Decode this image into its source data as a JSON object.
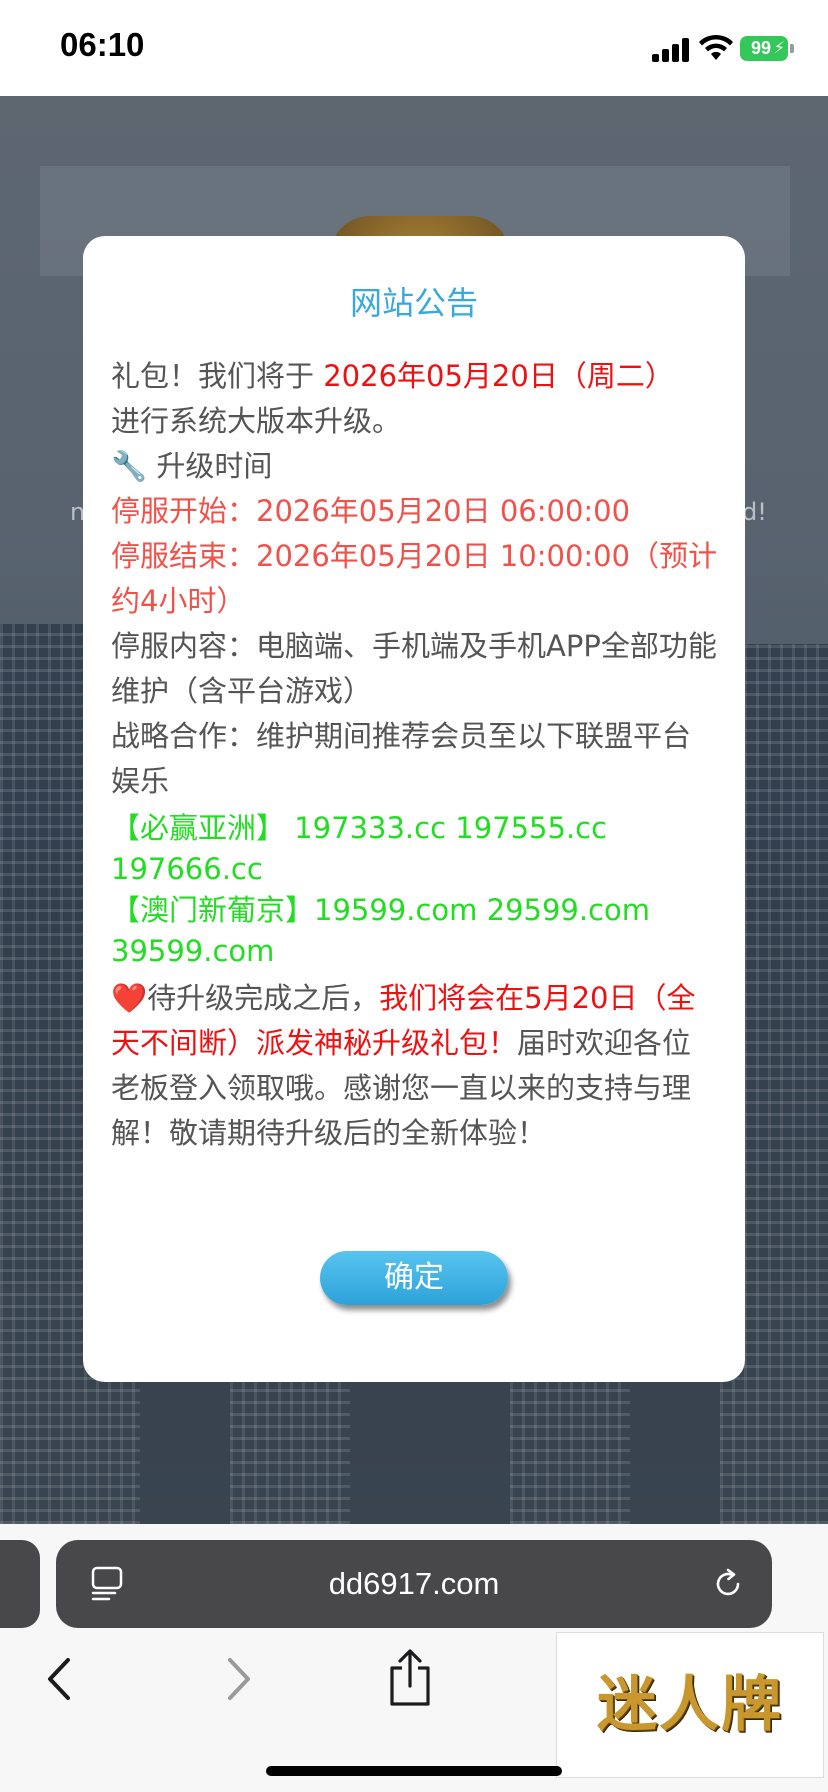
{
  "status_bar": {
    "time": "06:10",
    "battery": "99"
  },
  "background": {
    "marquee_left": "n",
    "marquee_right": "d!"
  },
  "modal": {
    "title": "网站公告",
    "intro_prefix": "礼包！我们将于 ",
    "intro_date": "2026年05月20日（周二）",
    "intro_suffix": "进行系统大版本升级。",
    "upgrade_time_icon": "🔧",
    "upgrade_time_label": " 升级时间",
    "stop_start": "停服开始：2026年05月20日 06:00:00",
    "stop_end": "停服结束：2026年05月20日 10:00:00（预计约4小时）",
    "stop_content": "停服内容：电脑端、手机端及手机APP全部功能维护（含平台游戏）",
    "partnership": "战略合作：维护期间推荐会员至以下联盟平台娱乐",
    "partner_1": "【必赢亚洲】  197333.cc  197555.cc  197666.cc",
    "partner_2": "【澳门新葡京】19599.com 29599.com 39599.com",
    "heart_icon": "❤️",
    "closing_prefix": "待升级完成之后，",
    "closing_red": "我们将会在5月20日（全天不间断）派发神秘升级礼包！",
    "closing_suffix": "届时欢迎各位老板登入领取哦。感谢您一直以来的支持与理解！敬请期待升级后的全新体验！",
    "confirm_label": "确定"
  },
  "browser": {
    "url": "dd6917.com"
  },
  "ad": {
    "logo_text": "迷人牌"
  },
  "colors": {
    "title_blue": "#3aa8dd",
    "red": "#ee1111",
    "salmon": "#f0524a",
    "green": "#22dd22",
    "battery_green": "#34c759"
  }
}
